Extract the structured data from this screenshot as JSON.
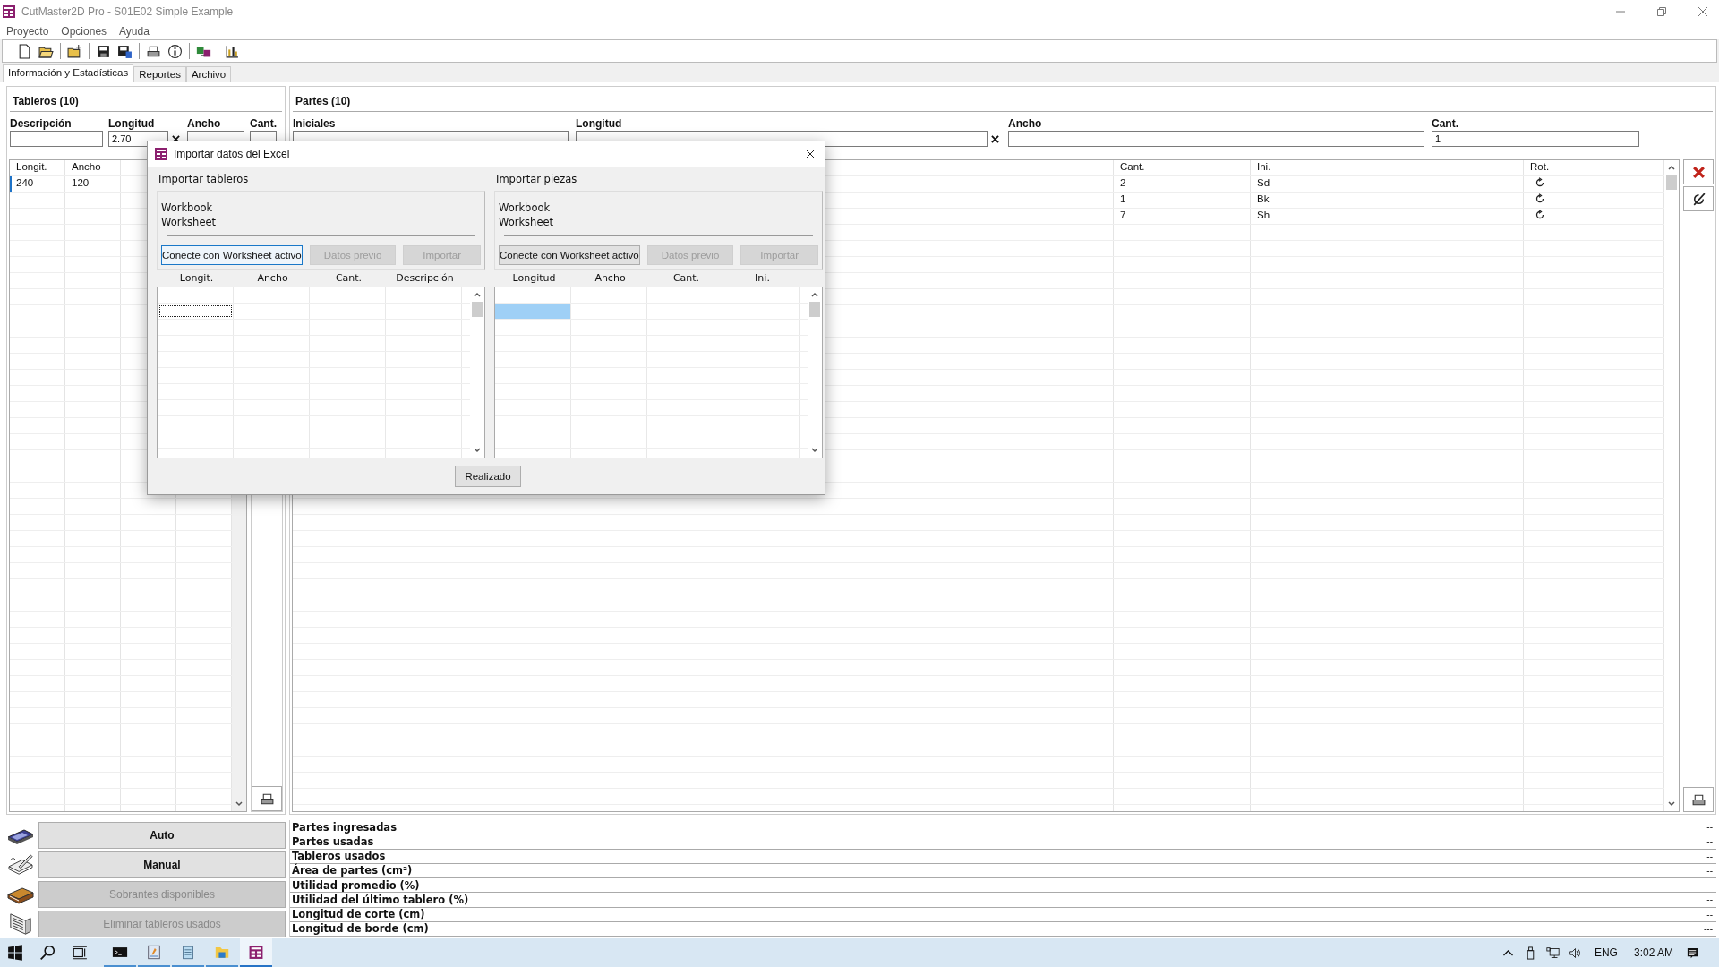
{
  "window": {
    "title": "CutMaster2D Pro - S01E02 Simple Example"
  },
  "menu": [
    "Proyecto",
    "Opciones",
    "Ayuda"
  ],
  "tabs": [
    {
      "label": "Información y Estadísticas",
      "selected": true
    },
    {
      "label": "Reportes",
      "selected": false
    },
    {
      "label": "Archivo",
      "selected": false
    }
  ],
  "tableros": {
    "title": "Tableros (10)",
    "fields": [
      {
        "label": "Descripción"
      },
      {
        "label": "Longitud",
        "value": "2.70"
      },
      {
        "label": "Ancho"
      },
      {
        "label": "Cant."
      }
    ],
    "columns": [
      "Longit.",
      "Ancho"
    ],
    "rows": [
      {
        "cells": [
          "240",
          "120"
        ],
        "selected": true
      }
    ]
  },
  "partes": {
    "title": "Partes (10)",
    "fields": [
      {
        "label": "Iniciales"
      },
      {
        "label": "Longitud"
      },
      {
        "label": "Ancho"
      },
      {
        "label": "Cant.",
        "value": "1"
      }
    ],
    "columns": [
      "Cant.",
      "Ini.",
      "Rot."
    ],
    "rows": [
      {
        "cells": [
          "2",
          "Sd"
        ],
        "rotatable": true,
        "selected": false
      },
      {
        "cells": [
          "1",
          "Bk"
        ],
        "rotatable": true,
        "selected": false
      },
      {
        "cells": [
          "7",
          "Sh"
        ],
        "rotatable": true,
        "selected": false
      }
    ]
  },
  "actions": [
    {
      "label": "Auto",
      "disabled": false,
      "kind": "calculator"
    },
    {
      "label": "Manual",
      "disabled": false,
      "kind": "pencil"
    },
    {
      "label": "Sobrantes disponibles",
      "disabled": true,
      "kind": "book"
    },
    {
      "label": "Eliminar tableros usados",
      "disabled": true,
      "kind": "boards"
    }
  ],
  "stats": [
    {
      "label": "Partes ingresadas",
      "value": "--"
    },
    {
      "label": "Partes usadas",
      "value": "--"
    },
    {
      "label": "Tableros usados",
      "value": "--"
    },
    {
      "label": "Área de partes (cm²)",
      "value": "--"
    },
    {
      "label": "Utilidad promedio (%)",
      "value": "--"
    },
    {
      "label": "Utilidad del último tablero (%)",
      "value": "--"
    },
    {
      "label": "Longitud de corte (cm)",
      "value": "--"
    },
    {
      "label": "Longitud de borde (cm)",
      "value": "---"
    }
  ],
  "dialog": {
    "title": "Importar datos del Excel",
    "done_button": "Realizado",
    "sections": [
      {
        "title": "Importar tableros",
        "workbook": "Workbook",
        "worksheet": "Worksheet",
        "cell_highlighted": false,
        "buttons": [
          {
            "label": "Conecte con Worksheet activo",
            "disabled": false,
            "focused": true
          },
          {
            "label": "Datos previo",
            "disabled": true,
            "focused": false
          },
          {
            "label": "Importar",
            "disabled": true,
            "focused": false
          }
        ],
        "columns": [
          "Longit.",
          "Ancho",
          "Cant.",
          "Descripción"
        ]
      },
      {
        "title": "Importar piezas",
        "workbook": "Workbook",
        "worksheet": "Worksheet",
        "cell_highlighted": true,
        "buttons": [
          {
            "label": "Conecte con Worksheet activo",
            "disabled": false,
            "focused": false
          },
          {
            "label": "Datos previo",
            "disabled": true,
            "focused": false
          },
          {
            "label": "Importar",
            "disabled": true,
            "focused": false
          }
        ],
        "columns": [
          "Longitud",
          "Ancho",
          "Cant.",
          "Ini."
        ]
      }
    ]
  },
  "taskbar": {
    "apps": [
      {
        "kind": "terminal",
        "selected": false
      },
      {
        "kind": "installer",
        "selected": false
      },
      {
        "kind": "notepad",
        "selected": false
      },
      {
        "kind": "folder",
        "selected": false
      },
      {
        "kind": "app",
        "selected": true
      }
    ],
    "language": "ENG",
    "time": "3:02 AM"
  }
}
